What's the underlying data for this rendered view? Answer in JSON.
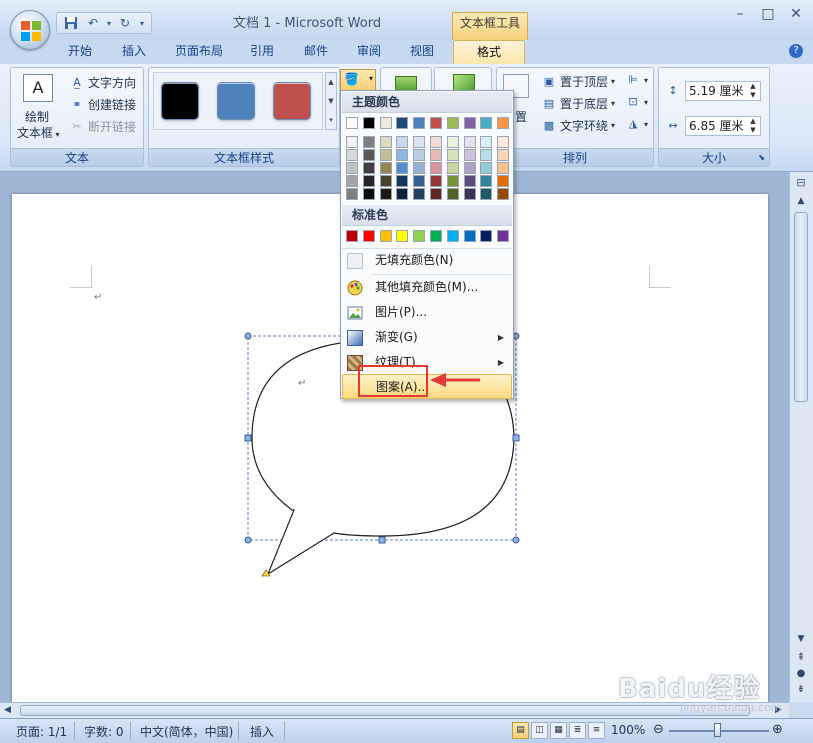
{
  "window": {
    "title": "文档 1 - Microsoft Word",
    "contextual_tab_title": "文本框工具"
  },
  "tabs": [
    {
      "label": "开始"
    },
    {
      "label": "插入"
    },
    {
      "label": "页面布局"
    },
    {
      "label": "引用"
    },
    {
      "label": "邮件"
    },
    {
      "label": "审阅"
    },
    {
      "label": "视图"
    },
    {
      "label": "格式",
      "active": true
    }
  ],
  "ribbon": {
    "text_group": {
      "label": "文本",
      "draw_textbox": "绘制",
      "draw_textbox_line2": "文本框",
      "text_direction": "文字方向",
      "create_link": "创建链接",
      "break_link": "断开链接"
    },
    "styles_group": {
      "label": "文本框样式",
      "swatches": [
        "#000000",
        "#4f81bd",
        "#c0504d"
      ]
    },
    "arrange_group": {
      "label": "排列",
      "bring_front": "置于顶层",
      "send_back": "置于底层",
      "text_wrap": "文字环绕",
      "position_partial": "置"
    },
    "size_group": {
      "label": "大小",
      "height": "5.19 厘米",
      "width": "6.85 厘米"
    }
  },
  "fill_menu": {
    "theme_colors_header": "主题颜色",
    "standard_colors_header": "标准色",
    "theme_top_row": [
      "#ffffff",
      "#000000",
      "#eeece1",
      "#1f497d",
      "#4f81bd",
      "#c0504d",
      "#9bbb59",
      "#8064a2",
      "#4bacc6",
      "#f79646"
    ],
    "theme_shades": [
      [
        "#f2f2f2",
        "#7f7f7f",
        "#ddd9c3",
        "#c6d9f0",
        "#dbe5f1",
        "#f2dcdb",
        "#ebf1dd",
        "#e5e0ec",
        "#dbeef3",
        "#fdeada"
      ],
      [
        "#d8d8d8",
        "#595959",
        "#c4bd97",
        "#8db3e2",
        "#b8cce4",
        "#e5b9b7",
        "#d7e3bc",
        "#ccc1d9",
        "#b7dde8",
        "#fbd5b5"
      ],
      [
        "#bfbfbf",
        "#3f3f3f",
        "#938953",
        "#548dd4",
        "#95b3d7",
        "#d99694",
        "#c3d69b",
        "#b2a2c7",
        "#92cddc",
        "#fac08f"
      ],
      [
        "#a5a5a5",
        "#262626",
        "#494429",
        "#17365d",
        "#366092",
        "#953734",
        "#76923c",
        "#5f497a",
        "#31859b",
        "#e36c09"
      ],
      [
        "#7f7f7f",
        "#0c0c0c",
        "#1d1b10",
        "#0f243e",
        "#244061",
        "#632423",
        "#4f6128",
        "#3f3151",
        "#205867",
        "#974806"
      ]
    ],
    "standard_colors": [
      "#c00000",
      "#ff0000",
      "#ffc000",
      "#ffff00",
      "#92d050",
      "#00b050",
      "#00b0f0",
      "#0070c0",
      "#002060",
      "#7030a0"
    ],
    "items": {
      "no_fill": "无填充颜色(N)",
      "more_colors": "其他填充颜色(M)...",
      "picture": "图片(P)...",
      "gradient": "渐变(G)",
      "texture": "纹理(T)",
      "pattern": "图案(A)..."
    }
  },
  "statusbar": {
    "page": "页面: 1/1",
    "words": "字数: 0",
    "language": "中文(简体，中国)",
    "mode": "插入",
    "zoom": "100%"
  },
  "watermark": {
    "logo": "Baidu经验",
    "url": "jingyan.baidu.com"
  }
}
